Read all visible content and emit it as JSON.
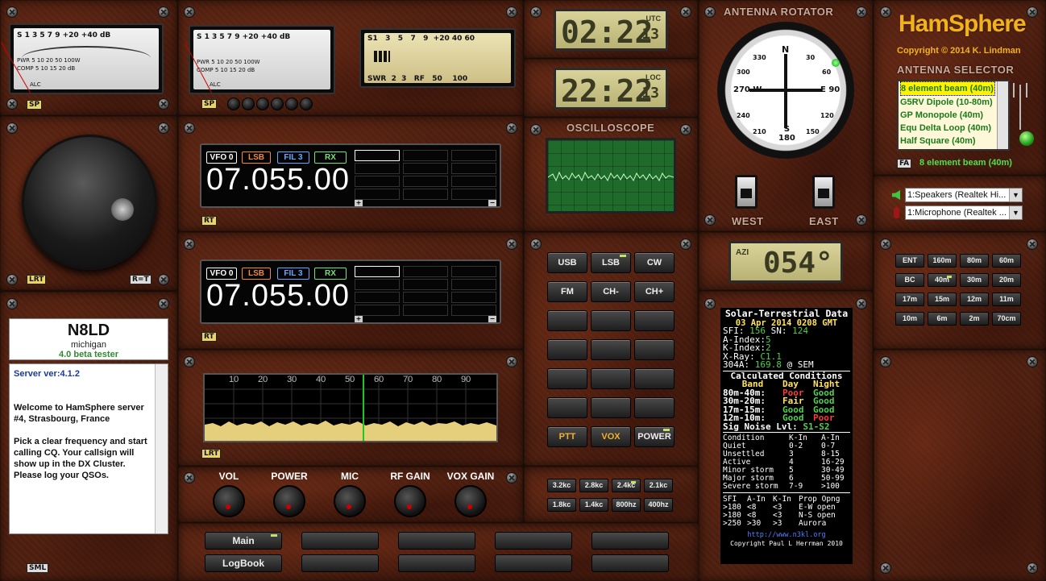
{
  "meters": {
    "meter1": {
      "tag": "SP",
      "scale_top": "S 1 3 5 7 9 +20 +40 dB",
      "row2": "PWR 5 10 20 50 100W",
      "row3": "COMP 5 10 15 20 dB",
      "row4": "ALC"
    },
    "meter2": {
      "tag": "SP",
      "scale_top": "S 1 3 5 7 9 +20 +40 dB",
      "row2": "PWR 5 10 20 50 100W",
      "row3": "COMP 5 10 15 20 dB",
      "row4": "ALC"
    },
    "swr": {
      "top": "S1   3   5   7   9  +20 40 60",
      "bottom": "SWR  2  3   RF   50    100"
    }
  },
  "clocks": {
    "utc": {
      "time": "02:22",
      "sec": "13",
      "label": "UTC"
    },
    "loc": {
      "time": "22:22",
      "sec": "13",
      "label": "LOC"
    }
  },
  "rotator": {
    "title": "ANTENNA ROTATOR",
    "west": "WEST",
    "east": "EAST",
    "azi_label": "AZI",
    "azi_value": "054°",
    "compass": {
      "n": "N",
      "e": "E 90",
      "s": "S\n180",
      "w": "270 W",
      "d30": "30",
      "d60": "60",
      "d120": "120",
      "d150": "150",
      "d210": "210",
      "d240": "240",
      "d300": "300",
      "d330": "330"
    }
  },
  "brand": {
    "name": "HamSphere",
    "copyright": "Copyright © 2014 K. Lindman"
  },
  "antenna_selector": {
    "title": "ANTENNA SELECTOR",
    "items": [
      "8 element beam (40m)",
      "G5RV Dipole (10-80m)",
      "GP Monopole (40m)",
      "Equ Delta Loop (40m)",
      "Half Square (40m)",
      "..."
    ],
    "selected": "8 element beam (40m)",
    "tag": "FA"
  },
  "audio": {
    "speakers": "1:Speakers (Realtek Hi...",
    "microphone": "1:Microphone (Realtek ..."
  },
  "bands": [
    "ENT",
    "160m",
    "80m",
    "60m",
    "BC",
    "40m",
    "30m",
    "20m",
    "17m",
    "15m",
    "12m",
    "11m",
    "10m",
    "6m",
    "2m",
    "70cm"
  ],
  "vfo1": {
    "vfo": "VFO 0",
    "mode": "LSB",
    "fil": "FIL 3",
    "rx": "RX",
    "freq": "07.055.00",
    "tag": "RT"
  },
  "vfo2": {
    "vfo": "VFO 0",
    "mode": "LSB",
    "fil": "FIL 3",
    "rx": "RX",
    "freq": "07.055.00",
    "tag": "RT"
  },
  "tuner": {
    "tag_l": "LRT",
    "tag_r": "R=T"
  },
  "oscilloscope": {
    "title": "OSCILLOSCOPE"
  },
  "modes": [
    "USB",
    "LSB",
    "CW",
    "FM",
    "CH-",
    "CH+"
  ],
  "controls": {
    "ptt": "PTT",
    "vox": "VOX",
    "power": "POWER"
  },
  "filters": [
    "3.2kc",
    "2.8kc",
    "2.4kc",
    "2.1kc",
    "1.8kc",
    "1.4kc",
    "800hz",
    "400hz"
  ],
  "spectrum": {
    "ticks": [
      "10",
      "20",
      "30",
      "40",
      "50",
      "60",
      "70",
      "80",
      "90"
    ],
    "tag": "LRT"
  },
  "knobs": [
    "VOL",
    "POWER",
    "MIC",
    "RF GAIN",
    "VOX GAIN"
  ],
  "bottom": {
    "main": "Main",
    "logbook": "LogBook"
  },
  "user": {
    "callsign": "N8LD",
    "location": "michigan",
    "role": "4.0 beta tester",
    "tag": "SML",
    "log": [
      "Server ver:4.1.2",
      "",
      "Welcome to HamSphere server #4, Strasbourg, France",
      "",
      "Pick a clear frequency and start calling CQ. Your callsign will show up in the DX Cluster. Please log your QSOs."
    ]
  },
  "solar": {
    "title": "Solar-Terrestrial Data",
    "date": "03 Apr 2014 0208 GMT",
    "sfi_l": "SFI:",
    "sfi": "156",
    "sn_l": "SN:",
    "sn": "124",
    "a_l": "A-Index:",
    "a": "5",
    "k_l": "K-Index:",
    "k": "2",
    "x_l": "X-Ray:",
    "x": "C1.1",
    "a304_l": "304A:",
    "a304": "169.8",
    "a304_s": "@ SEM",
    "calc": "Calculated Conditions",
    "h_band": "Band",
    "h_day": "Day",
    "h_night": "Night",
    "rows": [
      {
        "band": "80m-40m:",
        "day": "Poor",
        "night": "Good"
      },
      {
        "band": "30m-20m:",
        "day": "Fair",
        "night": "Good"
      },
      {
        "band": "17m-15m:",
        "day": "Good",
        "night": "Good"
      },
      {
        "band": "12m-10m:",
        "day": "Good",
        "night": "Poor"
      }
    ],
    "noise_l": "Sig Noise Lvl:",
    "noise": "S1-S2",
    "kh": [
      "Condition",
      "K-In",
      "A-In"
    ],
    "krows": [
      [
        "Quiet",
        "0-2",
        "0-7"
      ],
      [
        "Unsettled",
        "3",
        "8-15"
      ],
      [
        "Active",
        "4",
        "16-29"
      ],
      [
        "Minor storm",
        "5",
        "30-49"
      ],
      [
        "Major storm",
        "6",
        "50-99"
      ],
      [
        "Severe storm",
        "7-9",
        ">100"
      ]
    ],
    "ph": [
      "SFI",
      "A-In",
      "K-In",
      "Prop Opng"
    ],
    "prows": [
      [
        ">180",
        "<8",
        "<3",
        "E-W open"
      ],
      [
        ">180",
        "<8",
        "<3",
        "N-S open"
      ],
      [
        ">250",
        ">30",
        ">3",
        "Aurora"
      ]
    ],
    "url": "http://www.n3kl.org",
    "copy": "Copyright Paul L Herrman 2010"
  }
}
